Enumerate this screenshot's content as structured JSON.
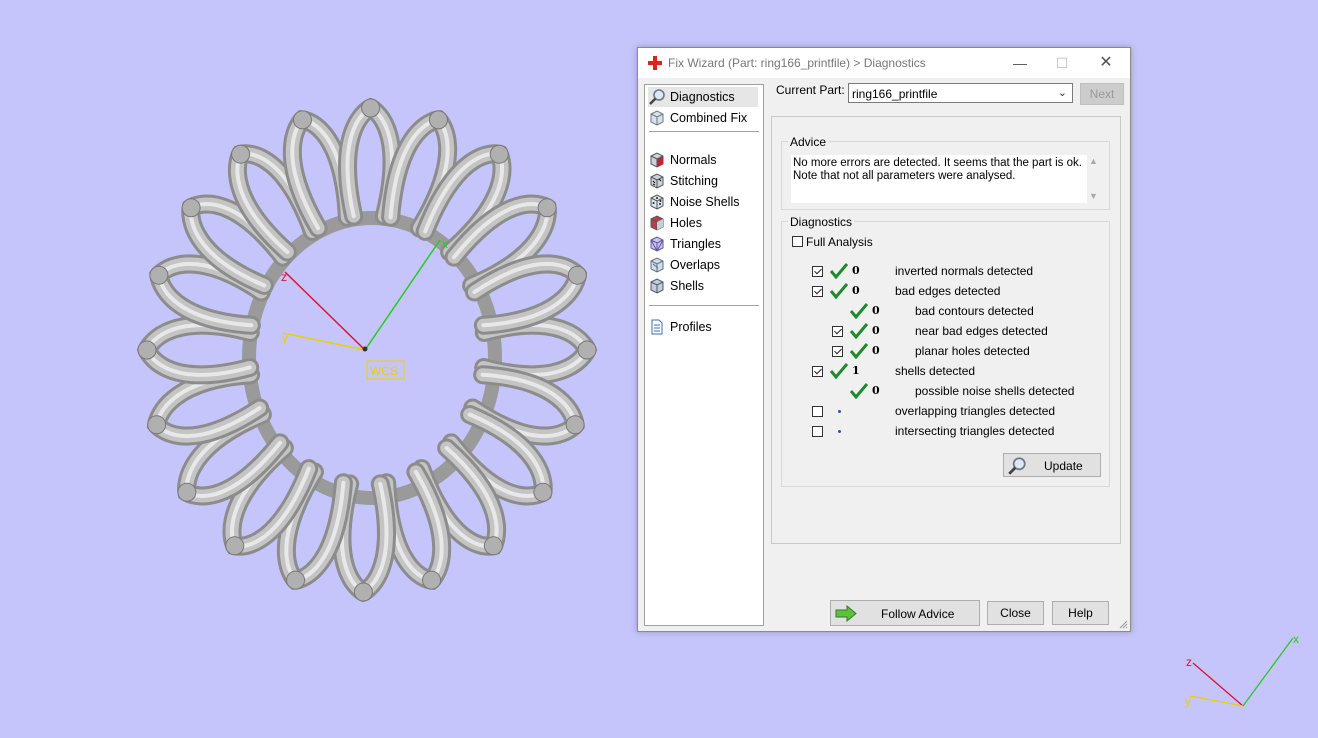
{
  "viewport": {
    "axis_labels": {
      "x": "x",
      "y": "y",
      "z": "z"
    },
    "wcs_label": "WCS",
    "mini_axis_labels": {
      "x": "x",
      "y": "y",
      "z": "z"
    },
    "colors": {
      "background": "#c5c5fb",
      "x_axis": "#22cc22",
      "y_axis": "#e6d200",
      "z_axis": "#dd1133",
      "model": "#b4b4b4"
    }
  },
  "dialog": {
    "title": "Fix Wizard (Part: ring166_printfile) > Diagnostics",
    "window_buttons": {
      "minimize": "—",
      "maximize": "☐",
      "close": "✕"
    },
    "nav": {
      "items": [
        {
          "label": "Diagnostics",
          "icon": "magnifier-icon",
          "selected": true
        },
        {
          "label": "Combined Fix",
          "icon": "cube-icon"
        },
        {
          "label": "Normals",
          "icon": "normals-cube-icon"
        },
        {
          "label": "Stitching",
          "icon": "stitching-cube-icon"
        },
        {
          "label": "Noise Shells",
          "icon": "dice-icon"
        },
        {
          "label": "Holes",
          "icon": "holes-cube-icon"
        },
        {
          "label": "Triangles",
          "icon": "triangles-cube-icon"
        },
        {
          "label": "Overlaps",
          "icon": "overlaps-cube-icon"
        },
        {
          "label": "Shells",
          "icon": "shells-cube-icon"
        },
        {
          "label": "Profiles",
          "icon": "document-icon"
        }
      ]
    },
    "current_part_label": "Current Part:",
    "current_part_value": "ring166_printfile",
    "next_label": "Next",
    "advice": {
      "title": "Advice",
      "text_line1": "No more errors are detected. It seems that the part is ok.",
      "text_line2": "Note that not all parameters were analysed."
    },
    "diagnostics": {
      "title": "Diagnostics",
      "full_analysis_label": "Full Analysis",
      "rows": [
        {
          "checked": true,
          "status": "ok",
          "count": "0",
          "label": "inverted normals detected"
        },
        {
          "checked": true,
          "status": "ok",
          "count": "0",
          "label": "bad edges detected"
        },
        {
          "status": "ok",
          "count": "0",
          "label": "bad contours detected"
        },
        {
          "checked": true,
          "status": "ok",
          "count": "0",
          "label": "near bad edges detected"
        },
        {
          "checked": true,
          "status": "ok",
          "count": "0",
          "label": "planar holes detected"
        },
        {
          "checked": true,
          "status": "ok",
          "count": "1",
          "label": "shells detected"
        },
        {
          "status": "ok",
          "count": "0",
          "label": "possible noise shells detected"
        },
        {
          "checked": false,
          "status": "pending",
          "label": "overlapping triangles detected"
        },
        {
          "checked": false,
          "status": "pending",
          "label": "intersecting triangles detected"
        }
      ],
      "update_label": "Update"
    },
    "footer": {
      "follow_advice_label": "Follow Advice",
      "close_label": "Close",
      "help_label": "Help"
    }
  }
}
